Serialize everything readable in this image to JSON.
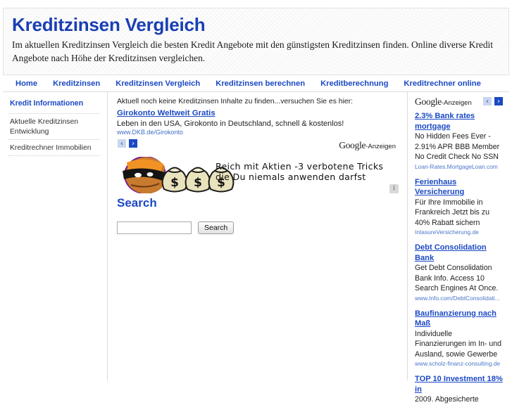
{
  "header": {
    "title": "Kreditzinsen Vergleich",
    "tagline": "Im aktuellen Kreditzinsen Vergleich die besten Kredit Angebote mit den günstigsten Kreditzinsen finden. Online diverse Kredit Angebote nach Höhe der Kreditzinsen vergleichen."
  },
  "nav": {
    "items": [
      {
        "label": "Home"
      },
      {
        "label": "Kreditzinsen"
      },
      {
        "label": "Kreditzinsen Vergleich"
      },
      {
        "label": "Kreditzinsen berechnen"
      },
      {
        "label": "Kreditberechnung"
      },
      {
        "label": "Kreditrechner online"
      }
    ]
  },
  "sidebar_left": {
    "heading": "Kredit Informationen",
    "items": [
      {
        "label": "Aktuelle Kreditzinsen Entwicklung"
      },
      {
        "label": "Kreditrechner Immobilien"
      }
    ]
  },
  "main": {
    "notice": "Aktuell noch keine Kreditzinsen Inhalte zu finden...versuchen Sie es hier:",
    "inline_ad": {
      "title": "Girokonto Weltweit Gratis",
      "description": "Leben in den USA, Girokonto in Deutschland, schnell & kostenlos!",
      "url": "www.DKB.de/Girokonto",
      "prev_arrow": "‹",
      "next_arrow": "›"
    },
    "google_ads_label": {
      "brand": "Google",
      "suffix": "-Anzeigen"
    },
    "banner": {
      "caption_line1": "Reich mit Aktien -3 verbotene Tricks",
      "caption_line2": "die Du niemals anwenden darfst",
      "info_badge": "i"
    },
    "search": {
      "heading": "Search",
      "input_value": "",
      "input_placeholder": "",
      "button_label": "Search"
    }
  },
  "sidebar_right": {
    "google_ads_label": {
      "brand": "Google",
      "suffix": "-Anzeigen"
    },
    "prev_arrow": "‹",
    "next_arrow": "›",
    "ads": [
      {
        "title": "2.3% Bank rates mortgage",
        "lines": [
          "No Hidden Fees Ever -",
          "2.91% APR BBB Member",
          "No Credit Check No SSN"
        ],
        "url": "Loan-Rates.MortgageLoan.com"
      },
      {
        "title": "Ferienhaus Versicherung",
        "lines": [
          "Für Ihre Immobilie in",
          "Frankreich Jetzt bis zu",
          "40% Rabatt sichern"
        ],
        "url": "IntasureVersicherung.de"
      },
      {
        "title": "Debt Consolidation Bank",
        "lines": [
          "Get Debt Consolidation",
          "Bank Info. Access 10",
          "Search Engines At Once."
        ],
        "url": "www.Info.com/DebtConsolidati..."
      },
      {
        "title": "Baufinanzierung nach Maß",
        "lines": [
          "Individuelle",
          "Finanzierungen im In- und",
          "Ausland, sowie Gewerbe"
        ],
        "url": "www.scholz-finanz-consulting.de"
      },
      {
        "title": "TOP 10 Investment 18% in",
        "lines": [
          "2009. Abgesicherte"
        ],
        "url": ""
      }
    ]
  },
  "colors": {
    "link_blue": "#1b49c4",
    "text": "#222222",
    "url_blue": "#4a77c9",
    "border": "#dcdcdc"
  }
}
